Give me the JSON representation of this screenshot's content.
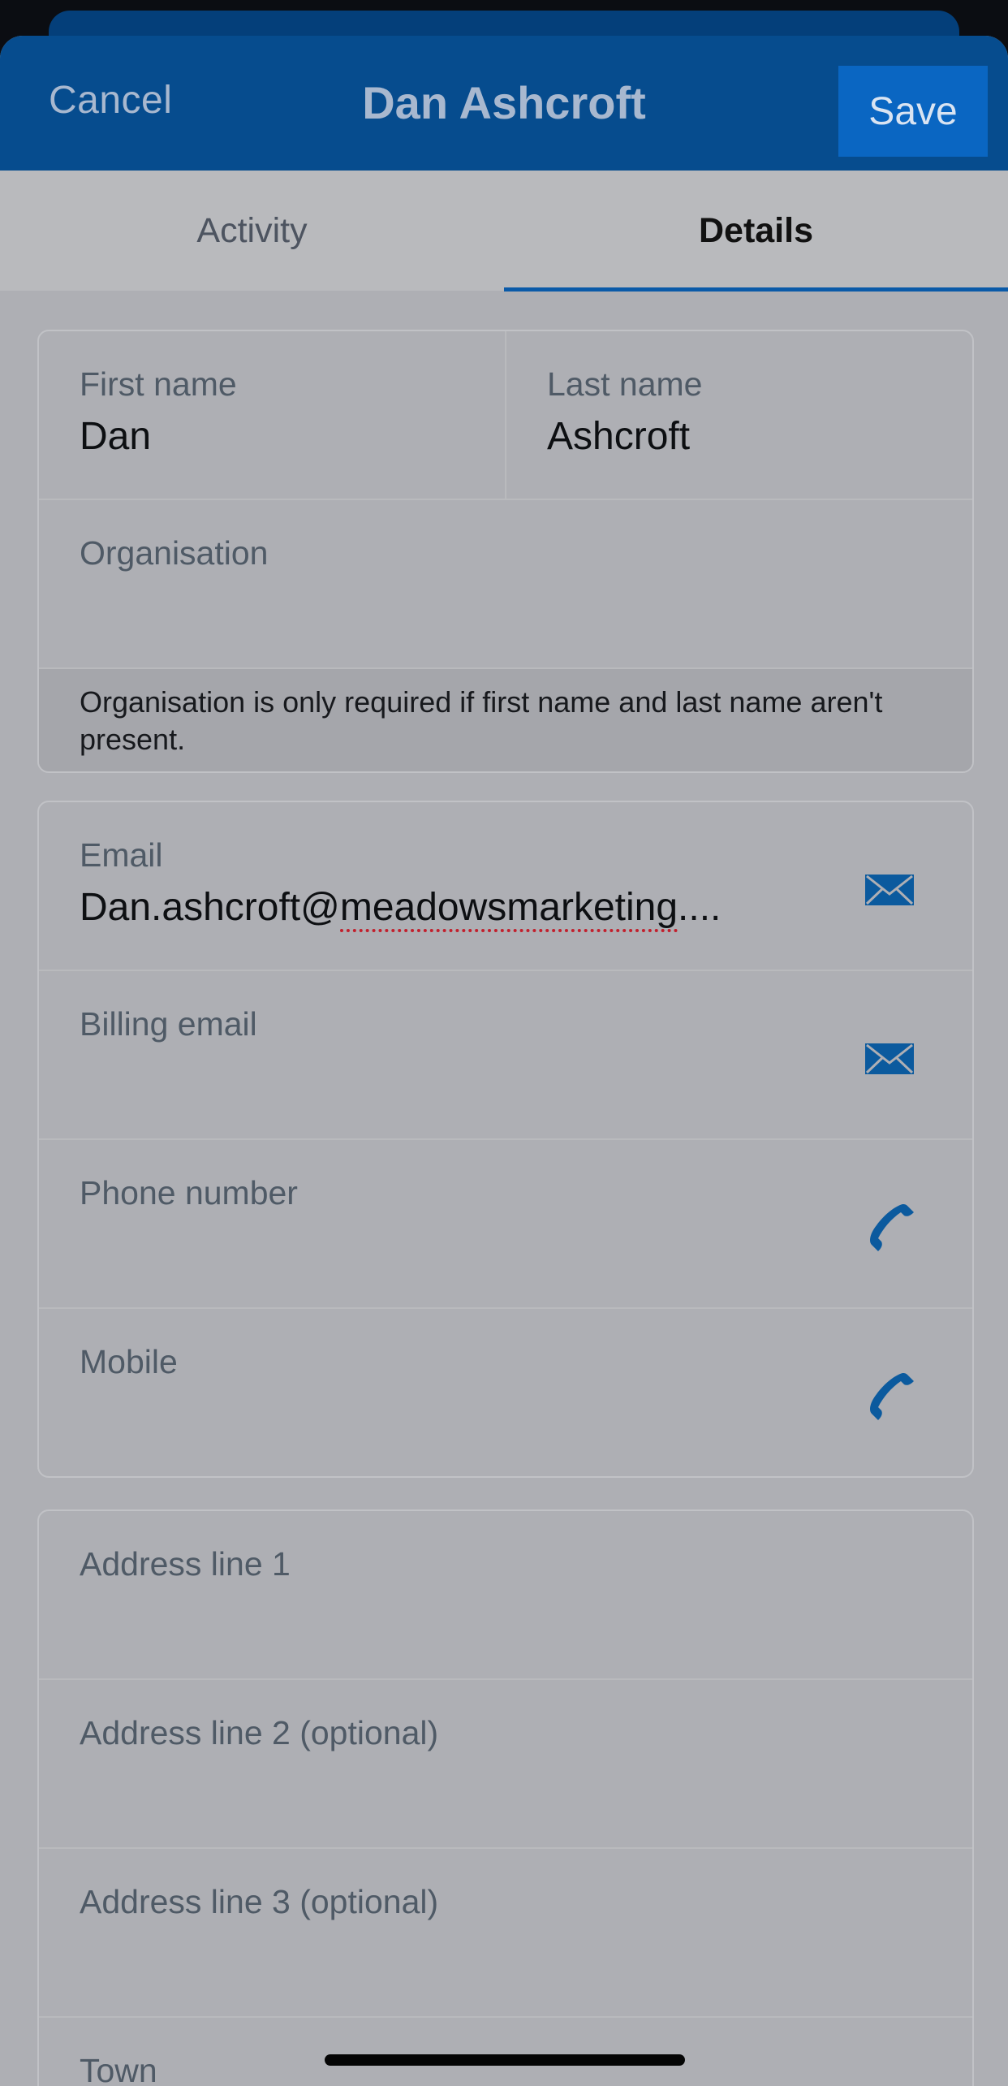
{
  "header": {
    "cancel_label": "Cancel",
    "title": "Dan Ashcroft",
    "save_label": "Save"
  },
  "tabs": [
    {
      "label": "Activity",
      "active": false
    },
    {
      "label": "Details",
      "active": true
    }
  ],
  "name_card": {
    "first_name_label": "First name",
    "first_name_value": "Dan",
    "last_name_label": "Last name",
    "last_name_value": "Ashcroft",
    "organisation_label": "Organisation",
    "organisation_value": "",
    "note": "Organisation is only required if first name and last name aren't present."
  },
  "contact_card": {
    "email_label": "Email",
    "email_value_prefix": "Dan.ashcroft@",
    "email_value_misspelled": "meadowsmarketing",
    "email_value_suffix": "....",
    "billing_email_label": "Billing email",
    "phone_label": "Phone number",
    "mobile_label": "Mobile",
    "email_icon": "envelope-icon",
    "phone_icon": "phone-icon"
  },
  "address_card": {
    "line1_label": "Address line 1",
    "line2_label": "Address line 2 (optional)",
    "line3_label": "Address line 3 (optional)",
    "town_label": "Town"
  },
  "colors": {
    "header_bg": "#064c8e",
    "save_bg": "#0a66c2",
    "accent": "#0a5aa8",
    "icon": "#0b5a9e"
  }
}
